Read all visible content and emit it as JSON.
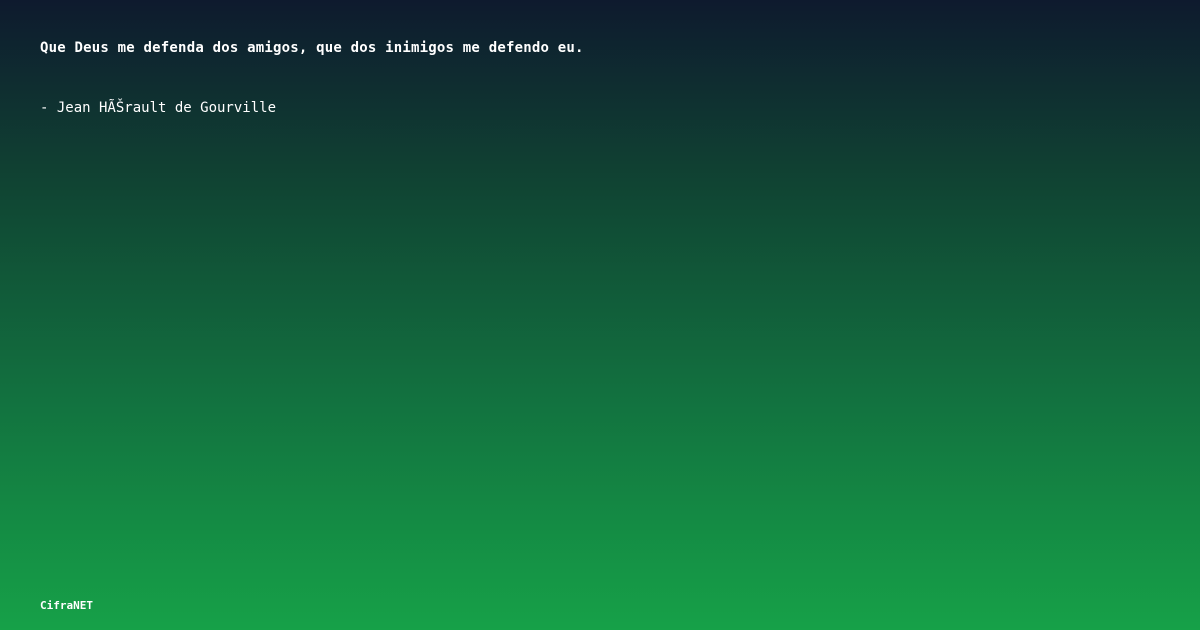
{
  "quote": {
    "text": "Que Deus me defenda dos amigos, que dos inimigos me defendo eu.",
    "author": "- Jean HÃŠrault de Gourville"
  },
  "footer": {
    "brand": "CifraNET"
  },
  "colors": {
    "gradient_top": "#0e1a2e",
    "gradient_bottom": "#16a148",
    "text": "#ffffff"
  }
}
